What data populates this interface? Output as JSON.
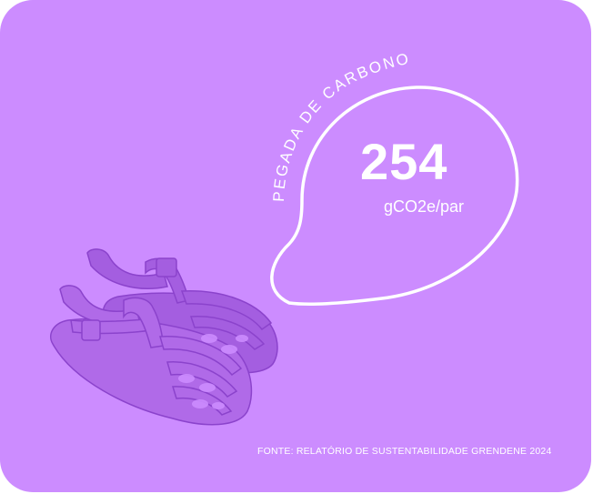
{
  "card": {
    "background_color": "#cc8cff",
    "arc_label": "PEGADA DE CARBONO",
    "metric_value": "254",
    "metric_unit": "gCO2e/par",
    "source_note": "FONTE: RELATÓRIO DE SUSTENTABILIDADE GRENDENE 2024"
  },
  "product_image": {
    "icon": "sandal-icon",
    "color": "#a45ee0"
  }
}
